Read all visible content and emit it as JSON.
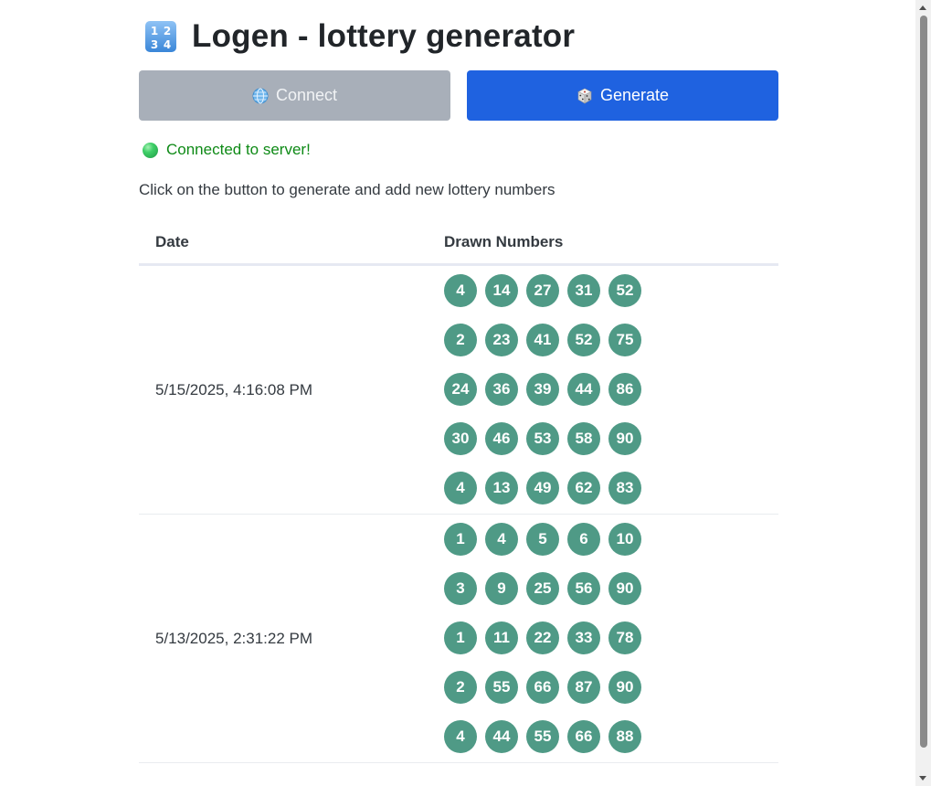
{
  "header": {
    "title": "Logen - lottery generator",
    "icon": "input-numbers-icon"
  },
  "buttons": {
    "connect_label": "Connect",
    "connect_icon": "globe-icon",
    "generate_label": "Generate",
    "generate_icon": "dice-icon"
  },
  "status": {
    "text": "Connected to server!",
    "icon": "green-circle-icon",
    "color": "#0e8a16"
  },
  "instructions": "Click on the button to generate and add new lottery numbers",
  "table": {
    "columns": [
      "Date",
      "Drawn Numbers"
    ],
    "rows": [
      {
        "date": "5/15/2025, 4:16:08 PM",
        "draws": [
          [
            "4",
            "14",
            "27",
            "31",
            "52"
          ],
          [
            "2",
            "23",
            "41",
            "52",
            "75"
          ],
          [
            "24",
            "36",
            "39",
            "44",
            "86"
          ],
          [
            "30",
            "46",
            "53",
            "58",
            "90"
          ],
          [
            "4",
            "13",
            "49",
            "62",
            "83"
          ]
        ]
      },
      {
        "date": "5/13/2025, 2:31:22 PM",
        "draws": [
          [
            "1",
            "4",
            "5",
            "6",
            "10"
          ],
          [
            "3",
            "9",
            "25",
            "56",
            "90"
          ],
          [
            "1",
            "11",
            "22",
            "33",
            "78"
          ],
          [
            "2",
            "55",
            "66",
            "87",
            "90"
          ],
          [
            "4",
            "44",
            "55",
            "66",
            "88"
          ]
        ]
      }
    ]
  },
  "colors": {
    "ball": "#4f9a86",
    "generate_button": "#1f62e0",
    "connect_button_disabled": "#a8afb9"
  }
}
